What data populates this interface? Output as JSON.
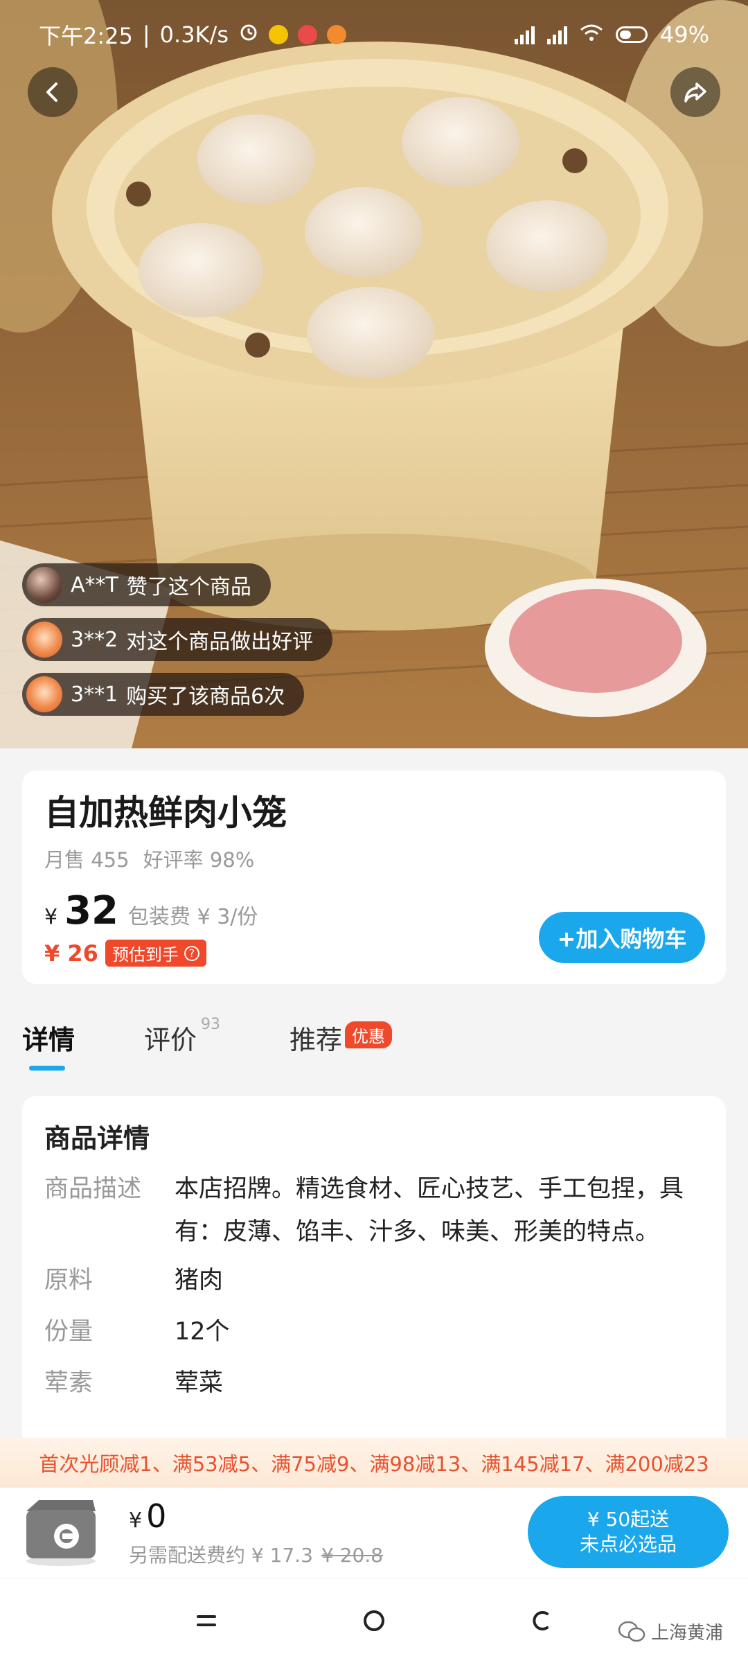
{
  "status_bar": {
    "time": "下午2:25",
    "speed": "0.3K/s",
    "battery": "49%"
  },
  "hero": {
    "alt": "自加热鲜肉小笼"
  },
  "activity": [
    {
      "user": "A**T",
      "text": "赞了这个商品"
    },
    {
      "user": "3**2",
      "text": "对这个商品做出好评"
    },
    {
      "user": "3**1",
      "text": "购买了该商品6次"
    }
  ],
  "product": {
    "title": "自加热鲜肉小笼",
    "monthly_sales_label": "月售",
    "monthly_sales": "455",
    "rating_label": "好评率",
    "rating": "98%",
    "currency": "¥",
    "price": "32",
    "pack_fee": "包装费 ¥ 3/份",
    "est_price": "¥ 26",
    "est_badge": "预估到手",
    "add_to_cart": "+加入购物车"
  },
  "tabs": [
    {
      "label": "详情",
      "active": true
    },
    {
      "label": "评价",
      "count": "93"
    },
    {
      "label": "推荐",
      "badge": "优惠"
    }
  ],
  "details": {
    "heading": "商品详情",
    "rows": [
      {
        "label": "商品描述",
        "value": "本店招牌。精选食材、匠心技艺、手工包捏，具有：皮薄、馅丰、汁多、味美、形美的特点。"
      },
      {
        "label": "原料",
        "value": "猪肉"
      },
      {
        "label": "份量",
        "value": "12个"
      },
      {
        "label": "荤素",
        "value": "荤菜"
      }
    ]
  },
  "promo": "首次光顾减1、满53减5、满75减9、满98减13、满145减17、满200减23",
  "cart": {
    "currency": "¥",
    "total": "0",
    "delivery_text": "另需配送费约 ¥ 17.3",
    "delivery_original": "¥ 20.8",
    "min_order_line1": "¥ 50起送",
    "min_order_line2": "未点必选品"
  },
  "watermark": "上海黄浦",
  "colors": {
    "accent": "#1aa7ec",
    "promo_red": "#f0482a"
  }
}
